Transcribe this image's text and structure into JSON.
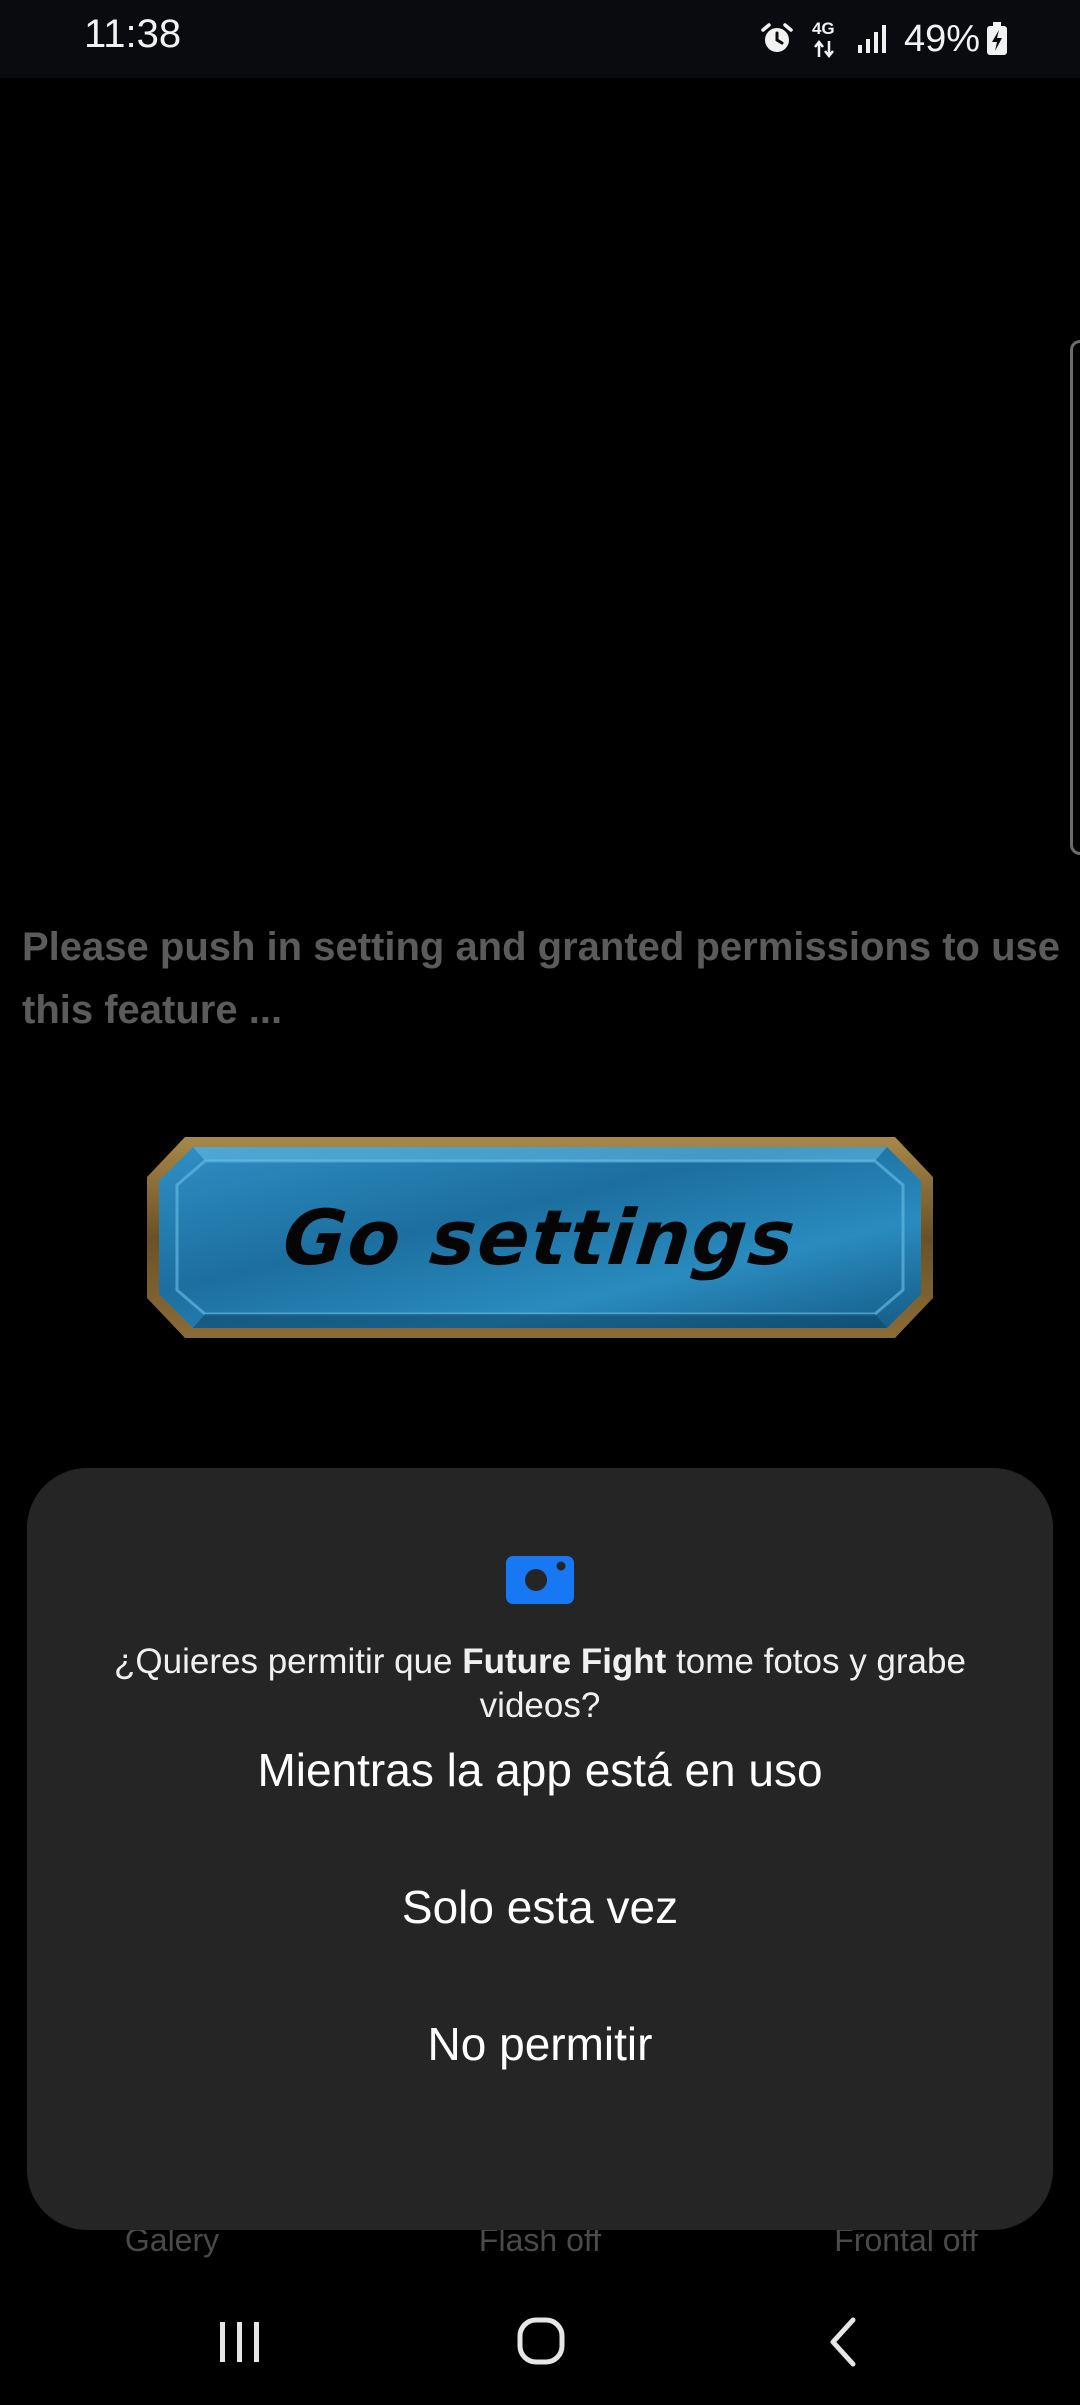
{
  "status_bar": {
    "time": "11:38",
    "network": "4G",
    "battery": "49%"
  },
  "app": {
    "message": "Please push in setting and granted permissions to use this feature ...",
    "go_settings_label": "Go settings",
    "bottom_labels": [
      "Galery",
      "Flash off",
      "Frontal off"
    ]
  },
  "permission_dialog": {
    "icon": "camera-icon",
    "message_prefix": "¿Quieres permitir que ",
    "app_name": "Future Fight",
    "message_suffix": " tome fotos y grabe videos?",
    "options": [
      "Mientras la app está en uso",
      "Solo esta vez",
      "No permitir"
    ],
    "accent_color": "#1877f2"
  },
  "navigation_bar": {
    "buttons": [
      "recent-apps-icon",
      "home-icon",
      "back-icon"
    ]
  }
}
